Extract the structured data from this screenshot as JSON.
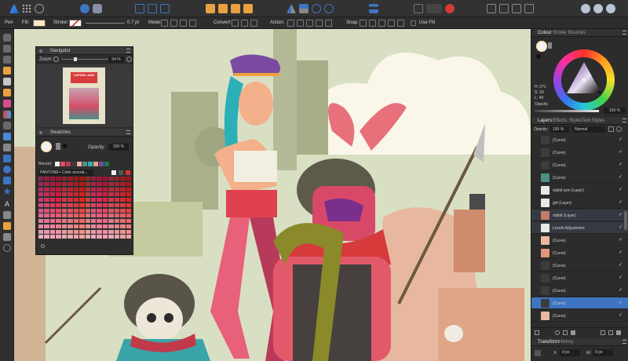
{
  "context_toolbar": {
    "tool_name": "Pen",
    "fill_label": "Fill:",
    "stroke_label": "Stroke:",
    "stroke_width": "0.7 pt",
    "mode_label": "Mode:",
    "convert_label": "Convert:",
    "action_label": "Action:",
    "snap_label": "Snap:",
    "use_fill_label": "Use Fill",
    "fill_color": "#fde8c4"
  },
  "navigator": {
    "title": "Navigator",
    "zoom_label": "Zoom:",
    "zoom_value": "94 %",
    "poster_title": "CAPEM LAND"
  },
  "swatches": {
    "title": "Swatches",
    "opacity_label": "Opacity:",
    "opacity_value": "100 %",
    "recent_label": "Recent:",
    "palette_name": "PANTONE+ Color uncoat..."
  },
  "colour_panel": {
    "tabs": [
      "Colour",
      "Stroke",
      "Brushes"
    ],
    "h_value": "H: 271",
    "s_value": "S: 29",
    "l_value": "L: 49",
    "opacity_label": "Opacity",
    "opacity_value": "100 %"
  },
  "layers_panel": {
    "tabs": [
      "Layers",
      "Effects",
      "Styles",
      "Text Styles"
    ],
    "opacity_label": "Opacity:",
    "opacity_value": "100 %",
    "blend_mode": "Normal",
    "rows": [
      {
        "name": "(Curve)",
        "thumb": "#3c3c3c"
      },
      {
        "name": "(Curve)",
        "thumb": "#3c3c3c"
      },
      {
        "name": "(Curve)",
        "thumb": "#3c3c3c"
      },
      {
        "name": "(Curve)",
        "thumb": "#4f8f86"
      },
      {
        "name": "rabbit arm (Layer)",
        "thumb": "#e8e8e8"
      },
      {
        "name": "girl (Layer)",
        "thumb": "#e8e8e8"
      },
      {
        "name": "rabbit (Layer)",
        "thumb": "#c47a6a"
      },
      {
        "name": "Levels Adjustment",
        "thumb": "#e8e8e8"
      },
      {
        "name": "(Curve)",
        "thumb": "#e8b79f"
      },
      {
        "name": "(Curve)",
        "thumb": "#e39577"
      },
      {
        "name": "(Curve)",
        "thumb": "#3c3c3c"
      },
      {
        "name": "(Curve)",
        "thumb": "#3c3c3c"
      },
      {
        "name": "(Curve)",
        "thumb": "#3c3c3c"
      },
      {
        "name": "(Curve)",
        "thumb": "#3c3c3c"
      },
      {
        "name": "(Curve)",
        "thumb": "#e8b79f"
      }
    ],
    "selected_index": 13
  },
  "bottom_tabs": [
    "Transform",
    "History"
  ],
  "transform": {
    "x_label": "X:",
    "x_value": "0 px",
    "w_label": "W:",
    "w_value": "0 px"
  },
  "colors": {
    "accent": "#3d75c2",
    "canvas_bg": "#d9dfc2",
    "panel_bg": "#2c2c2c"
  }
}
